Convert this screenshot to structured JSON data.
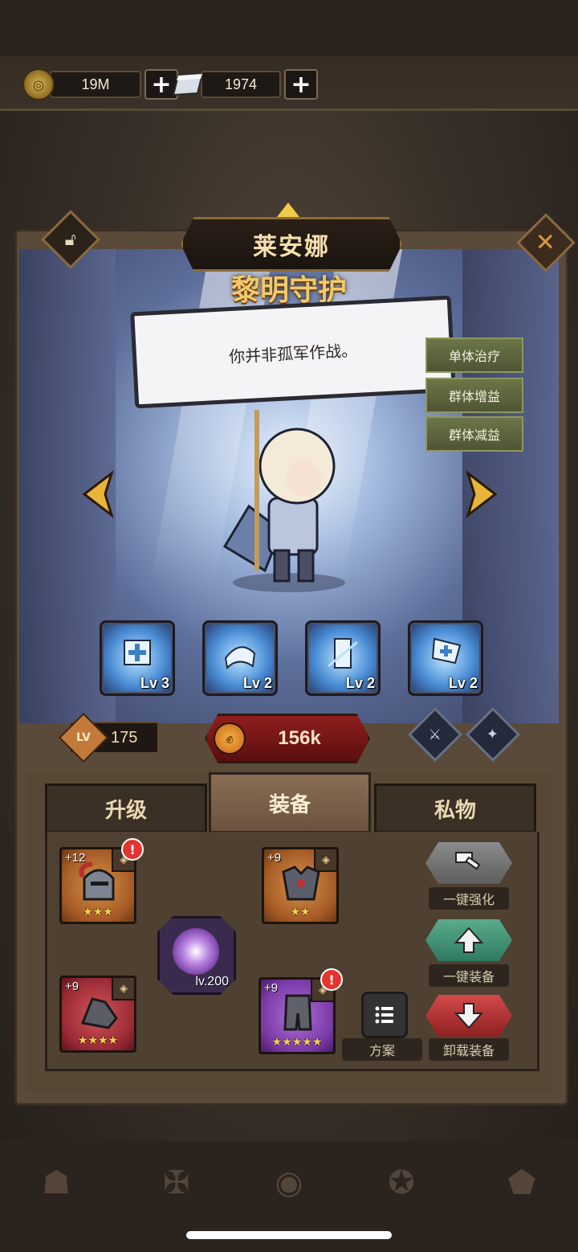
{
  "currency": {
    "gold": "19M",
    "gems": "1974"
  },
  "hero": {
    "name": "莱安娜",
    "title": "黎明守护",
    "quote": "你并非孤军作战。",
    "tags": [
      "单体治疗",
      "群体增益",
      "群体减益"
    ],
    "level_label": "LV",
    "level": "175",
    "power": "156k"
  },
  "skills": [
    {
      "level": "Lv 3"
    },
    {
      "level": "Lv 2"
    },
    {
      "level": "Lv 2"
    },
    {
      "level": "Lv 2"
    }
  ],
  "tabs": [
    "升级",
    "装备",
    "私物"
  ],
  "active_tab": "装备",
  "equipment": {
    "helmet": {
      "enhance": "+12",
      "stars": "★★★",
      "alert": "!"
    },
    "chest": {
      "enhance": "+9",
      "stars": "★★"
    },
    "gloves": {
      "enhance": "+9",
      "stars": "★★★★"
    },
    "boots": {
      "enhance": "+9",
      "stars": "★★★★★",
      "alert": "!"
    },
    "core": {
      "level": "lv.200"
    }
  },
  "actions": {
    "enhance_all": "一键强化",
    "equip_all": "一键装备",
    "plan": "方案",
    "unequip_all": "卸载装备"
  },
  "colors": {
    "gold_text": "#f2c96a",
    "power_red": "#8f1f1e",
    "panel_brown": "#574836"
  }
}
